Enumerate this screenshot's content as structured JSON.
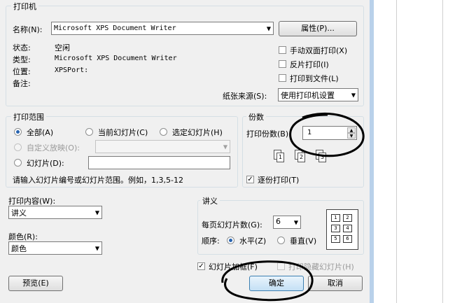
{
  "printer": {
    "section_label": "打印机",
    "name_label": "名称(N):",
    "name_value": "Microsoft XPS Document Writer",
    "properties_button": "属性(P)...",
    "status_label": "状态:",
    "status_value": "空闲",
    "type_label": "类型:",
    "type_value": "Microsoft XPS Document Writer",
    "where_label": "位置:",
    "where_value": "XPSPort:",
    "comment_label": "备注:",
    "manual_duplex": "手动双面打印(X)",
    "reverse_print": "反片打印(I)",
    "print_to_file": "打印到文件(L)",
    "paper_source_label": "纸张来源(S):",
    "paper_source_value": "使用打印机设置"
  },
  "range": {
    "section_label": "打印范围",
    "all": "全部(A)",
    "current_slide": "当前幻灯片(C)",
    "selection": "选定幻灯片(H)",
    "custom_show": "自定义放映(O):",
    "slides": "幻灯片(D):",
    "hint": "请输入幻灯片编号或幻灯片范围。例如，1,3,5-12"
  },
  "copies": {
    "section_label": "份数",
    "count_label": "打印份数(B):",
    "count_value": "1",
    "collate": "逐份打印(T)",
    "collate_icons": [
      "1",
      "2",
      "3"
    ]
  },
  "content": {
    "print_what_label": "打印内容(W):",
    "print_what_value": "讲义",
    "color_label": "颜色(R):",
    "color_value": "颜色"
  },
  "handouts": {
    "section_label": "讲义",
    "per_page_label": "每页幻灯片数(G):",
    "per_page_value": "6",
    "order_label": "顺序:",
    "horizontal": "水平(Z)",
    "vertical": "垂直(V)",
    "layout_cells": [
      "1",
      "2",
      "3",
      "4",
      "5",
      "6"
    ]
  },
  "options": {
    "frame_slides": "幻灯片加框(F)",
    "print_hidden": "打印隐藏幻灯片(H)"
  },
  "footer": {
    "preview": "预览(E)",
    "ok": "确定",
    "cancel": "取消"
  },
  "colors": {
    "dialog_bg": "#f0f0f0",
    "accent": "#3c7fb1",
    "annotation": "#000000"
  }
}
